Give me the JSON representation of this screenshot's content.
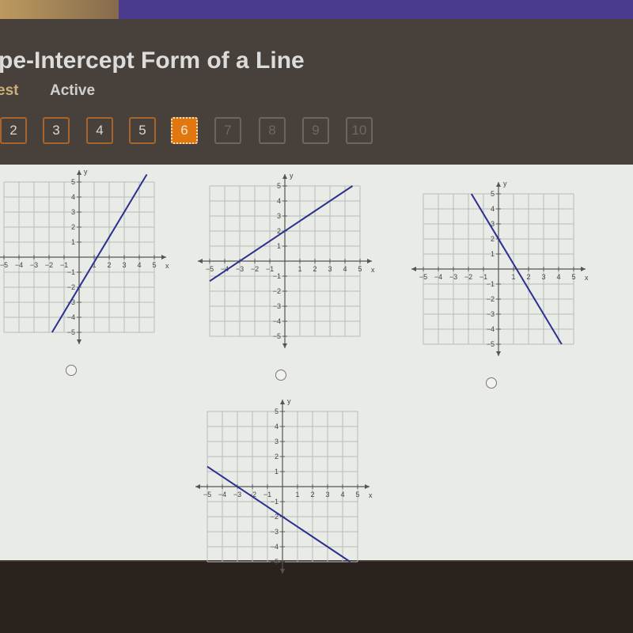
{
  "header": {
    "title": "pe-Intercept Form of a Line",
    "tabs": [
      {
        "label": "est",
        "state": "partial"
      },
      {
        "label": "Active",
        "state": "active"
      }
    ]
  },
  "pagination": {
    "pages": [
      {
        "label": "2",
        "state": "visited"
      },
      {
        "label": "3",
        "state": "visited"
      },
      {
        "label": "4",
        "state": "visited"
      },
      {
        "label": "5",
        "state": "visited"
      },
      {
        "label": "6",
        "state": "current"
      },
      {
        "label": "7",
        "state": "locked"
      },
      {
        "label": "8",
        "state": "locked"
      },
      {
        "label": "9",
        "state": "locked"
      },
      {
        "label": "10",
        "state": "locked"
      }
    ],
    "current_color": "#e0780f"
  },
  "graphs": {
    "axis": {
      "xlabel": "x",
      "ylabel": "y",
      "min": -5,
      "max": 5
    },
    "line_color": "#2b2f8f",
    "options": [
      {
        "id": "a",
        "slope": 1.6667,
        "intercept": -2,
        "x_range": [
          -1.8,
          4.5
        ]
      },
      {
        "id": "b",
        "slope": 0.6667,
        "intercept": 2,
        "x_range": [
          -5,
          4.5
        ]
      },
      {
        "id": "c",
        "slope": -1.6667,
        "intercept": 2,
        "x_range": [
          -1.8,
          4.2
        ]
      },
      {
        "id": "d",
        "slope": -0.6667,
        "intercept": -2,
        "x_range": [
          -5,
          4.5
        ]
      }
    ]
  },
  "chart_data": {
    "type": "line",
    "title": "",
    "xlabel": "x",
    "ylabel": "y",
    "xlim": [
      -5,
      5
    ],
    "ylim": [
      -5,
      5
    ],
    "grid": true,
    "series": [
      {
        "name": "option a: y = 5/3x - 2",
        "points": [
          [
            -1.8,
            -5
          ],
          [
            4.2,
            5
          ]
        ]
      },
      {
        "name": "option b: y = 2/3x + 2",
        "points": [
          [
            -5,
            -1.33
          ],
          [
            4.5,
            5
          ]
        ]
      },
      {
        "name": "option c: y = -5/3x + 2",
        "points": [
          [
            -1.8,
            5
          ],
          [
            4.2,
            -5
          ]
        ]
      },
      {
        "name": "option d: y = -2/3x - 2",
        "points": [
          [
            -5,
            1.33
          ],
          [
            4.5,
            -5
          ]
        ]
      }
    ]
  }
}
